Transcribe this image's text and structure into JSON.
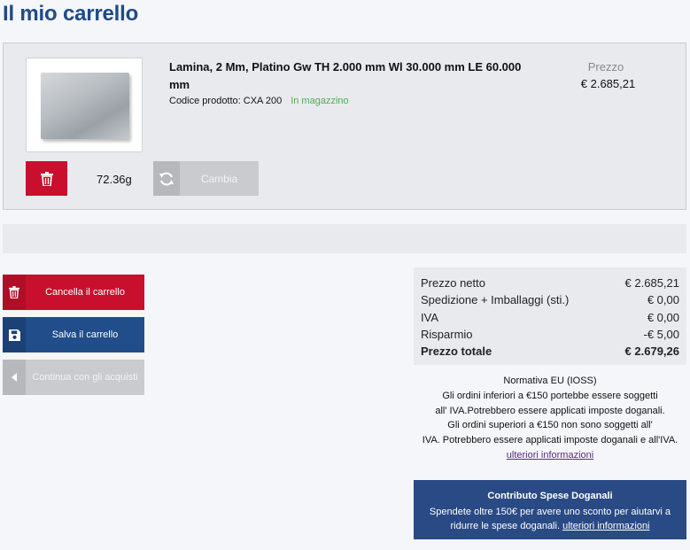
{
  "page": {
    "title": "Il mio carrello"
  },
  "item": {
    "name": "Lamina, 2 Mm, Platino Gw TH 2.000 mm Wl 30.000 mm LE 60.000 mm",
    "code_label": "Codice prodotto: CXA 200",
    "stock": "In magazzino",
    "price_label": "Prezzo",
    "price": "€ 2.685,21",
    "weight": "72.36g",
    "change_label": "Cambia"
  },
  "actions": {
    "clear_label": "Cancella il carrello",
    "save_label": "Salva il carrello",
    "continue_label": "Continua con gli acquisti"
  },
  "summary": {
    "rows": [
      {
        "label": "Prezzo netto",
        "value": "€ 2.685,21"
      },
      {
        "label": "Spedizione + Imballaggi (sti.)",
        "value": "€ 0,00"
      },
      {
        "label": "IVA",
        "value": "€ 0,00"
      },
      {
        "label": "Risparmio",
        "value": "-€ 5,00"
      },
      {
        "label": "Prezzo totale",
        "value": "€ 2.679,26"
      }
    ]
  },
  "notice": {
    "line1": "Normativa EU (IOSS)",
    "line2": "Gli ordini inferiori a €150 portebbe essere soggetti",
    "line3": "all' IVA.Potrebbero essere applicati imposte doganali.",
    "line4": "Gli ordini superiori a €150 non sono soggetti all'",
    "line5": "IVA. Potrebbero essere applicati imposte doganali e all'IVA.",
    "link": "ulteriori informazioni"
  },
  "promo": {
    "title": "Contributo Spese Doganali",
    "text": "Spendete oltre 150€ per avere uno sconto per aiutarvi a ridurre le spese doganali.",
    "link": "ulteriori informazioni"
  },
  "colors": {
    "primary": "#214d8a",
    "danger": "#c8102e",
    "success": "#4caf50",
    "disabled": "#c9cbce"
  },
  "icons": {
    "delete": "trash-icon",
    "change": "refresh-icon",
    "save": "floppy-disk-icon",
    "back": "caret-left-icon"
  }
}
